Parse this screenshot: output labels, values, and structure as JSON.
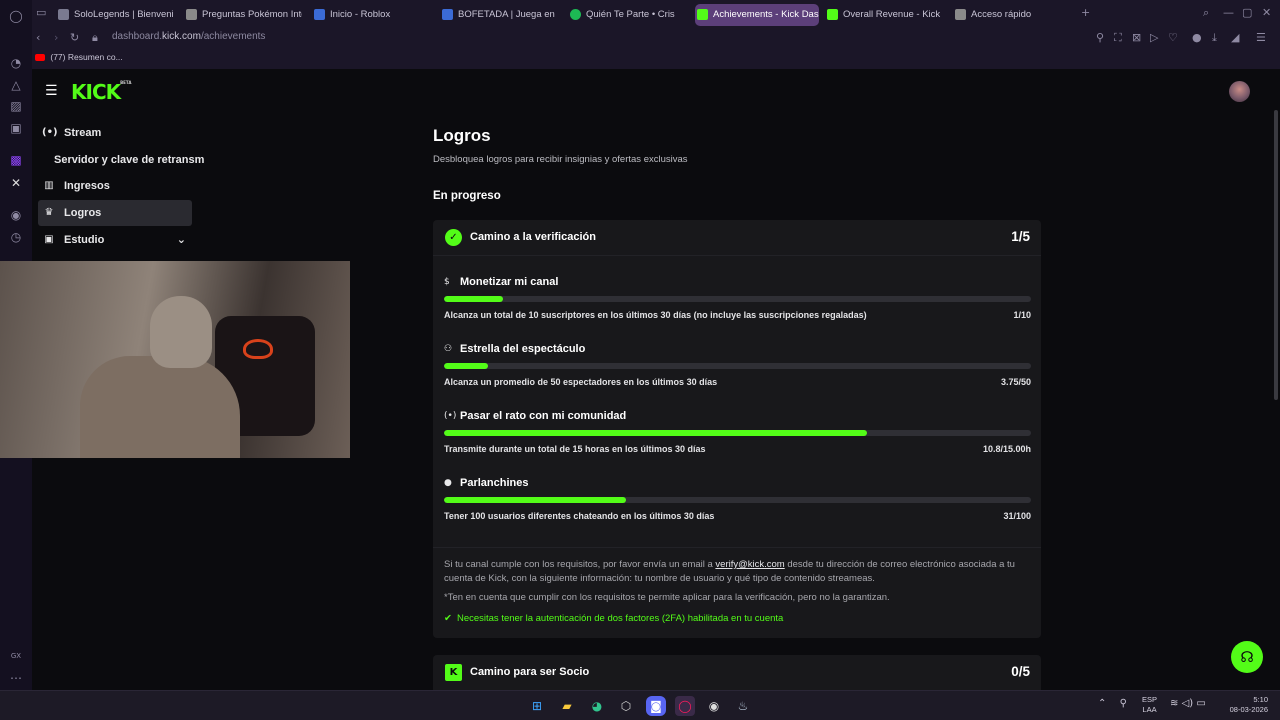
{
  "browser": {
    "tabs": [
      {
        "label": "SoloLegends | Bienvenido",
        "color": "#7a7a90"
      },
      {
        "label": "Preguntas Pokémon Inter",
        "color": "#8a8a8a"
      },
      {
        "label": "Inicio - Roblox",
        "color": "#3b6bd6"
      },
      {
        "label": "BOFETADA | Juega en Ro",
        "color": "#3b6bd6"
      },
      {
        "label": "Quién Te Parte • Cris",
        "color": "#1db954"
      },
      {
        "label": "Achievements - Kick Dash",
        "color": "#53fc18"
      },
      {
        "label": "Overall Revenue - Kick Da",
        "color": "#53fc18"
      },
      {
        "label": "Acceso rápido",
        "color": "#8a8a8a"
      }
    ],
    "url_prefix": "dashboard.",
    "url_host": "kick.com",
    "url_path": "/achievements",
    "bookmark": "(77) Resumen co..."
  },
  "kick": {
    "logo": "KICK",
    "logo_tag": "BETA",
    "sidebar": [
      {
        "label": "Stream",
        "icon": "stream-icon"
      },
      {
        "label": "Servidor y clave de retransm",
        "icon": ""
      },
      {
        "label": "Ingresos",
        "icon": "revenue-icon"
      },
      {
        "label": "Logros",
        "icon": "trophy-icon"
      },
      {
        "label": "Estudio",
        "icon": "studio-icon"
      }
    ],
    "page_title": "Logros",
    "page_subtitle": "Desbloquea logros para recibir insignias y ofertas exclusivas",
    "section_title": "En progreso",
    "card_verification": {
      "title": "Camino a la verificación",
      "count": "1/5",
      "achievements": [
        {
          "name": "Monetizar mi canal",
          "desc": "Alcanza un total de 10 suscriptores en los últimos 30 días (no incluye las suscripciones regaladas)",
          "value": "1/10",
          "progress": 0.1
        },
        {
          "name": "Estrella del espectáculo",
          "desc": "Alcanza un promedio de 50 espectadores en los últimos 30 días",
          "value": "3.75/50",
          "progress": 0.075
        },
        {
          "name": "Pasar el rato con mi comunidad",
          "desc": "Transmite durante un total de 15 horas en los últimos 30 días",
          "value": "10.8/15.00h",
          "progress": 0.72
        },
        {
          "name": "Parlanchines",
          "desc": "Tener 100 usuarios diferentes chateando en los últimos 30 días",
          "value": "31/100",
          "progress": 0.31
        }
      ],
      "footer_p1_a": "Si tu canal cumple con los requisitos, por favor envía un email a ",
      "footer_email": "verify@kick.com",
      "footer_p1_b": " desde tu dirección de correo electrónico asociada a tu cuenta de Kick, con la siguiente información: tu nombre de usuario y qué tipo de contenido streameas.",
      "footer_note": "*Ten en cuenta que cumplir con los requisitos te permite aplicar para la verificación, pero no la garantizan.",
      "footer_2fa": "Necesitas tener la autenticación de dos factores (2FA) habilitada en tu cuenta"
    },
    "card_partner": {
      "title": "Camino para ser Socio",
      "count": "0/5"
    }
  },
  "taskbar": {
    "lang_line1": "ESP",
    "lang_line2": "LAA",
    "time": "5:10",
    "date": "08-03-2026"
  },
  "colors": {
    "accent": "#53fc18",
    "background": "#0b0b0e",
    "card": "#18181b"
  }
}
